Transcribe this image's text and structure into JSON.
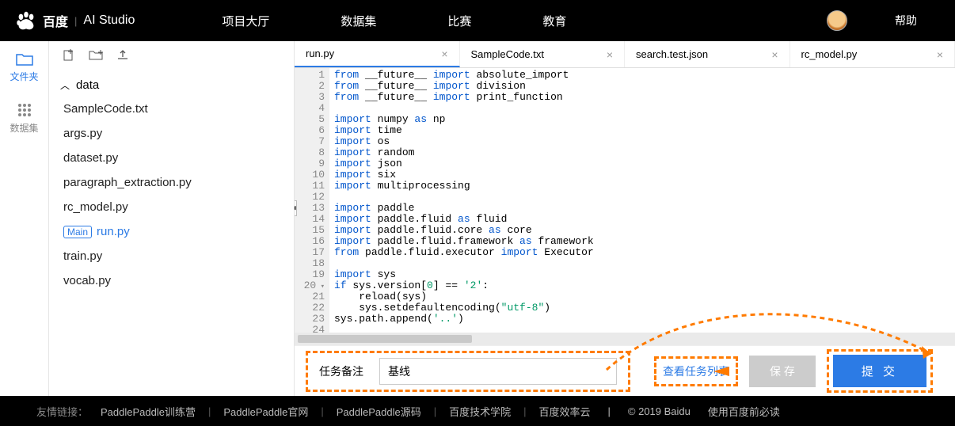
{
  "header": {
    "brand_cn": "百度",
    "brand_product": "AI Studio",
    "nav": [
      "项目大厅",
      "数据集",
      "比赛",
      "教育"
    ],
    "help": "帮助"
  },
  "rail": {
    "files": "文件夹",
    "dataset": "数据集"
  },
  "tree": {
    "root": "data",
    "files": [
      "SampleCode.txt",
      "args.py",
      "dataset.py",
      "paragraph_extraction.py",
      "rc_model.py",
      "run.py",
      "train.py",
      "vocab.py"
    ],
    "main_badge": "Main",
    "active_index": 5
  },
  "tabs": [
    "run.py",
    "SampleCode.txt",
    "search.test.json",
    "rc_model.py"
  ],
  "active_tab": 0,
  "code": [
    {
      "n": 1,
      "t": "from __future__ import absolute_import",
      "kw": [
        "from",
        "import"
      ]
    },
    {
      "n": 2,
      "t": "from __future__ import division",
      "kw": [
        "from",
        "import"
      ]
    },
    {
      "n": 3,
      "t": "from __future__ import print_function",
      "kw": [
        "from",
        "import"
      ]
    },
    {
      "n": 4,
      "t": ""
    },
    {
      "n": 5,
      "t": "import numpy as np",
      "kw": [
        "import",
        "as"
      ]
    },
    {
      "n": 6,
      "t": "import time",
      "kw": [
        "import"
      ]
    },
    {
      "n": 7,
      "t": "import os",
      "kw": [
        "import"
      ]
    },
    {
      "n": 8,
      "t": "import random",
      "kw": [
        "import"
      ]
    },
    {
      "n": 9,
      "t": "import json",
      "kw": [
        "import"
      ]
    },
    {
      "n": 10,
      "t": "import six",
      "kw": [
        "import"
      ]
    },
    {
      "n": 11,
      "t": "import multiprocessing",
      "kw": [
        "import"
      ]
    },
    {
      "n": 12,
      "t": ""
    },
    {
      "n": 13,
      "t": "import paddle",
      "kw": [
        "import"
      ]
    },
    {
      "n": 14,
      "t": "import paddle.fluid as fluid",
      "kw": [
        "import",
        "as"
      ]
    },
    {
      "n": 15,
      "t": "import paddle.fluid.core as core",
      "kw": [
        "import",
        "as"
      ]
    },
    {
      "n": 16,
      "t": "import paddle.fluid.framework as framework",
      "kw": [
        "import",
        "as"
      ]
    },
    {
      "n": 17,
      "t": "from paddle.fluid.executor import Executor",
      "kw": [
        "from",
        "import"
      ]
    },
    {
      "n": 18,
      "t": ""
    },
    {
      "n": 19,
      "t": "import sys",
      "kw": [
        "import"
      ]
    },
    {
      "n": 20,
      "t": "if sys.version[0] == '2':",
      "kw": [
        "if"
      ],
      "str": "'2'",
      "fold": true
    },
    {
      "n": 21,
      "t": "    reload(sys)"
    },
    {
      "n": 22,
      "t": "    sys.setdefaultencoding(\"utf-8\")",
      "str": "\"utf-8\""
    },
    {
      "n": 23,
      "t": "sys.path.append('..')",
      "str": "'..'"
    },
    {
      "n": 24,
      "t": ""
    }
  ],
  "action": {
    "remark_label": "任务备注",
    "remark_value": "基线",
    "view_tasks": "查看任务列表",
    "save": "保 存",
    "submit": "提 交"
  },
  "footer": {
    "label": "友情链接：",
    "links": [
      "PaddlePaddle训练营",
      "PaddlePaddle官网",
      "PaddlePaddle源码",
      "百度技术学院",
      "百度效率云"
    ],
    "copyright": "© 2019 Baidu",
    "terms": "使用百度前必读"
  }
}
